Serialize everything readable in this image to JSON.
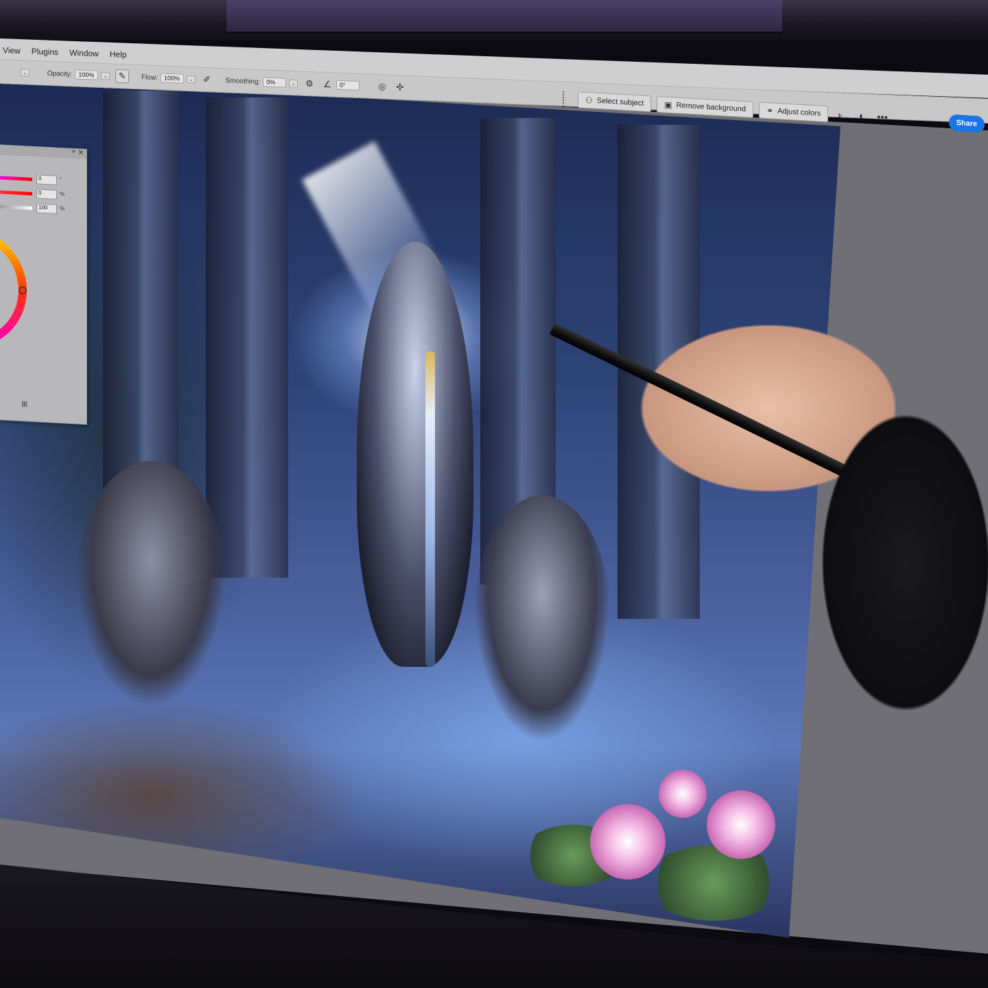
{
  "menubar": {
    "items": [
      "View",
      "Plugins",
      "Window",
      "Help"
    ]
  },
  "options_bar": {
    "opacity_label": "Opacity:",
    "opacity_value": "100%",
    "flow_label": "Flow:",
    "flow_value": "100%",
    "smoothing_label": "Smoothing:",
    "smoothing_value": "0%",
    "angle_value": "0°"
  },
  "context_bar": {
    "select_subject": "Select subject",
    "remove_background": "Remove background",
    "adjust_colors": "Adjust colors",
    "more": "•••"
  },
  "share_label": "Share",
  "color_panel": {
    "values": [
      {
        "value": "0",
        "unit": "°"
      },
      {
        "value": "0",
        "unit": "%"
      },
      {
        "value": "100",
        "unit": "%"
      }
    ]
  },
  "colors": {
    "accent_blue": "#1a73e8",
    "ui_gray": "#c8c8c8",
    "workspace_gray": "#6f6f75"
  },
  "icons": {
    "brush_pressure": "pen-pressure-icon",
    "airbrush": "airbrush-icon",
    "settings": "gear-icon",
    "angle": "angle-icon",
    "symmetry": "butterfly-icon",
    "crop": "crop-icon",
    "mask": "mask-icon"
  }
}
